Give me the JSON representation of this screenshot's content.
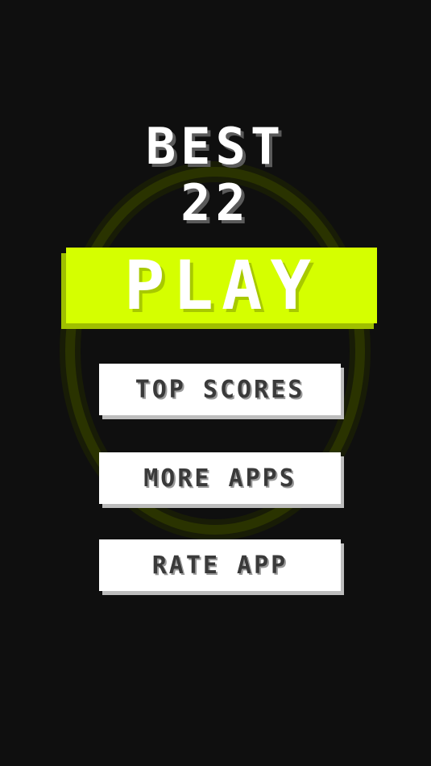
{
  "best": {
    "label": "BEST",
    "value": "22"
  },
  "play": {
    "label": "PLAY"
  },
  "menu": {
    "top_scores_label": "TOP SCORES",
    "more_apps_label": "MORE APPS",
    "rate_app_label": "RATE APP"
  },
  "colors": {
    "background": "#0f0f0f",
    "accent": "#d5ff00",
    "ring": "#3d4a00",
    "button_bg": "#ffffff",
    "button_text": "#3a3a3a"
  }
}
